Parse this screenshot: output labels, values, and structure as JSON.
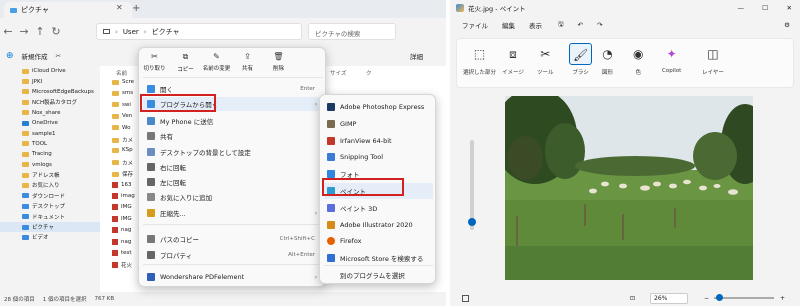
{
  "explorer": {
    "tab_title": "ピクチャ",
    "address": {
      "crumb1": "User",
      "crumb2": "ピクチャ"
    },
    "search_placeholder": "ピクチャの検索",
    "toolbar": {
      "new_label": "新規作成",
      "details_label": "詳細"
    },
    "sidebar": [
      "iCloud Drive",
      "JPKI",
      "MicrosoftEdgeBackups",
      "NCH製品カタログ",
      "Nox_share",
      "OneDrive",
      "sample1",
      "TOOL",
      "Tracing",
      "vmlogs",
      "アドレス帳",
      "お気に入り",
      "ダウンロード",
      "デスクトップ",
      "ドキュメント",
      "ピクチャ",
      "ビデオ"
    ],
    "columns": {
      "name": "名前",
      "size": "サイズ",
      "type": "ク"
    },
    "files": [
      "Scre",
      "sms",
      "swi",
      "Ven",
      "Wo",
      "カメ",
      "KSp",
      "カメ",
      "保存",
      "163",
      "imag",
      "IMG",
      "IMG",
      "nag",
      "nag",
      "test",
      "花火"
    ],
    "status": {
      "count": "28 個の項目",
      "selected": "1 個の項目を選択",
      "size": "767 KB"
    }
  },
  "context_menu": {
    "top": [
      "切り取り",
      "コピー",
      "名前の変更",
      "共有",
      "削除"
    ],
    "items": [
      {
        "label": "開く",
        "shortcut": "Enter"
      },
      {
        "label": "プログラムから開く",
        "arrow": "›"
      },
      {
        "label": "My Phone に送信"
      },
      {
        "label": "共有"
      },
      {
        "label": "デスクトップの背景として設定"
      },
      {
        "label": "右に回転"
      },
      {
        "label": "左に回転"
      },
      {
        "label": "お気に入りに追加"
      },
      {
        "label": "圧縮先...",
        "arrow": "›"
      },
      {
        "label": "パスのコピー",
        "shortcut": "Ctrl+Shift+C"
      },
      {
        "label": "プロパティ",
        "shortcut": "Alt+Enter"
      },
      {
        "label": "Wondershare PDFelement",
        "arrow": "›"
      }
    ]
  },
  "submenu": {
    "items": [
      "Adobe Photoshop Express",
      "GIMP",
      "IrfanView 64-bit",
      "Snipping Tool",
      "フォト",
      "ペイント",
      "ペイント 3D",
      "Adobe Illustrator 2020",
      "Firefox",
      "Microsoft Store を検索する",
      "別のプログラムを選択"
    ]
  },
  "paint": {
    "title": "花火.jpg - ペイント",
    "menu": [
      "ファイル",
      "編集",
      "表示"
    ],
    "ribbon": [
      "選択した部分",
      "イメージ",
      "ツール",
      "ブラシ",
      "図形",
      "色",
      "Copilot",
      "レイヤー"
    ],
    "zoom": "26%"
  },
  "colors": {
    "highlight": "#d32020",
    "accent": "#0067c0",
    "grass": "#5f8a3a",
    "sky": "#dfe6ea"
  }
}
